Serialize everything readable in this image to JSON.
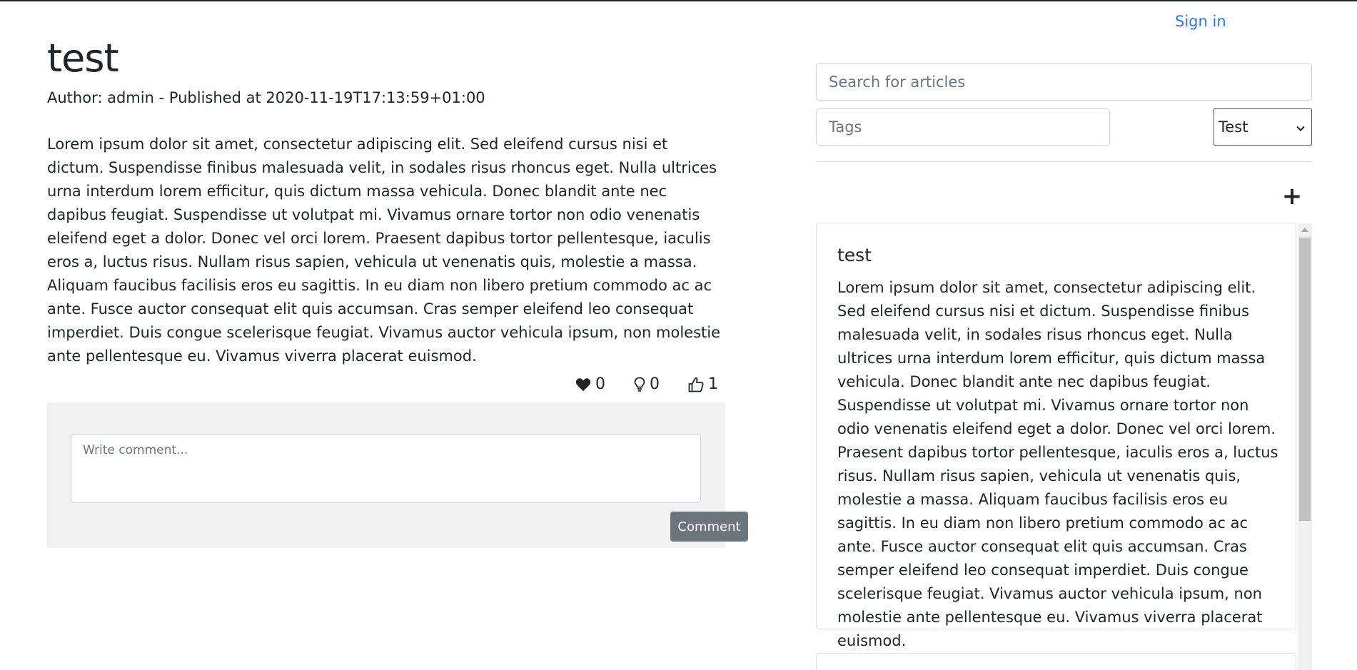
{
  "header": {
    "signin_label": "Sign in"
  },
  "article": {
    "title": "test",
    "meta": "Author: admin - Published at 2020-11-19T17:13:59+01:00",
    "body": "Lorem ipsum dolor sit amet, consectetur adipiscing elit. Sed eleifend cursus nisi et dictum. Suspendisse finibus malesuada velit, in sodales risus rhoncus eget. Nulla ultrices urna interdum lorem efficitur, quis dictum massa vehicula. Donec blandit ante nec dapibus feugiat. Suspendisse ut volutpat mi. Vivamus ornare tortor non odio venenatis eleifend eget a dolor. Donec vel orci lorem. Praesent dapibus tortor pellentesque, iaculis eros a, luctus risus. Nullam risus sapien, vehicula ut venenatis quis, molestie a massa. Aliquam faucibus facilisis eros eu sagittis. In eu diam non libero pretium commodo ac ac ante. Fusce auctor consequat elit quis accumsan. Cras semper eleifend leo consequat imperdiet. Duis congue scelerisque feugiat. Vivamus auctor vehicula ipsum, non molestie ante pellentesque eu. Vivamus viverra placerat euismod.",
    "reactions": [
      {
        "icon": "heart-icon",
        "count": "0"
      },
      {
        "icon": "lightbulb-icon",
        "count": "0"
      },
      {
        "icon": "thumbs-up-icon",
        "count": "1"
      }
    ]
  },
  "comment": {
    "placeholder": "Write comment...",
    "button_label": "Comment"
  },
  "sidebar": {
    "search_placeholder": "Search for articles",
    "tags_placeholder": "Tags",
    "select_value": "Test",
    "add_icon": "plus-icon",
    "cards": [
      {
        "title": "test",
        "body": "Lorem ipsum dolor sit amet, consectetur adipiscing elit. Sed eleifend cursus nisi et dictum. Suspendisse finibus malesuada velit, in sodales risus rhoncus eget. Nulla ultrices urna interdum lorem efficitur, quis dictum massa vehicula. Donec blandit ante nec dapibus feugiat. Suspendisse ut volutpat mi. Vivamus ornare tortor non odio venenatis eleifend eget a dolor. Donec vel orci lorem. Praesent dapibus tortor pellentesque, iaculis eros a, luctus risus. Nullam risus sapien, vehicula ut venenatis quis, molestie a massa. Aliquam faucibus facilisis eros eu sagittis. In eu diam non libero pretium commodo ac ac ante. Fusce auctor consequat elit quis accumsan. Cras semper eleifend leo consequat imperdiet. Duis congue scelerisque feugiat. Vivamus auctor vehicula ipsum, non molestie ante pellentesque eu. Vivamus viverra placerat euismod."
      }
    ]
  },
  "colors": {
    "link": "#2a7ad8",
    "button": "#6c757d",
    "comment_bg": "#f1f1f1"
  }
}
